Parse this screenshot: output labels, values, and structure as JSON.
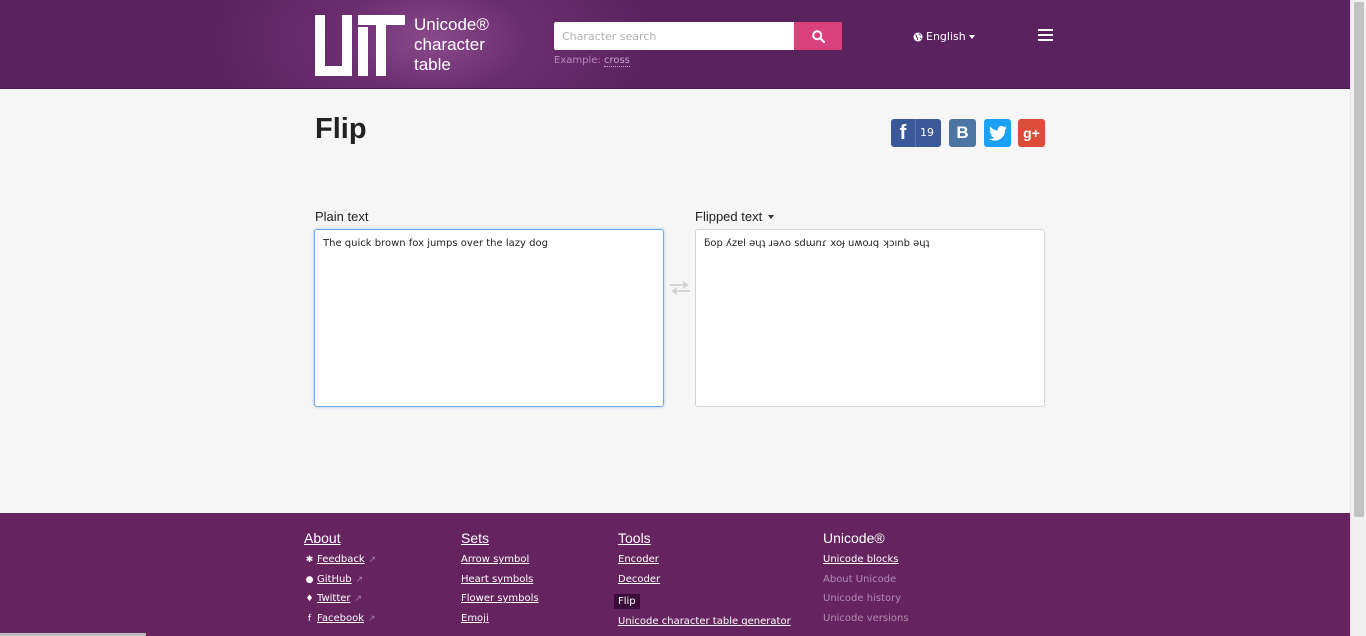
{
  "header": {
    "logo_lines": [
      "Unicode®",
      "character",
      "table"
    ],
    "search_placeholder": "Character search",
    "example_label": "Example:",
    "example_value": "cross",
    "language": "English"
  },
  "main": {
    "title": "Flip",
    "share": {
      "facebook_count": "19",
      "vk_letter": "B",
      "gplus_label": "g+"
    },
    "plain_label": "Plain text",
    "flipped_label": "Flipped text",
    "plain_value": "The quick brown fox jumps over the lazy dog",
    "flipped_value": "ƃop ʎzɐl ǝɥʇ ɹǝʌo sdɯnɾ xoɟ uʍoɹq ʞɔınb ǝɥʇ"
  },
  "footer": {
    "about": {
      "title": "About",
      "items": [
        "Feedback",
        "GitHub",
        "Twitter",
        "Facebook"
      ]
    },
    "sets": {
      "title": "Sets",
      "items": [
        "Arrow symbol",
        "Heart symbols",
        "Flower symbols",
        "Emoji"
      ]
    },
    "tools": {
      "title": "Tools",
      "items": [
        "Encoder",
        "Decoder",
        "Flip",
        "Unicode character table generator"
      ]
    },
    "unicode": {
      "title": "Unicode®",
      "items": [
        "Unicode blocks",
        "About Unicode",
        "Unicode history",
        "Unicode versions"
      ]
    }
  },
  "colors": {
    "header_bg": "#5a2360",
    "footer_bg": "#65235f",
    "search_button": "#d9427a",
    "facebook": "#3b5998",
    "vk": "#4c75a3",
    "twitter": "#1da1f2",
    "google_plus": "#dd4b39"
  },
  "icons": [
    "search-icon",
    "globe-icon",
    "hamburger-menu-icon",
    "swap-arrows-icon",
    "bug-icon",
    "github-icon",
    "twitter-icon",
    "facebook-icon",
    "external-link-icon"
  ]
}
